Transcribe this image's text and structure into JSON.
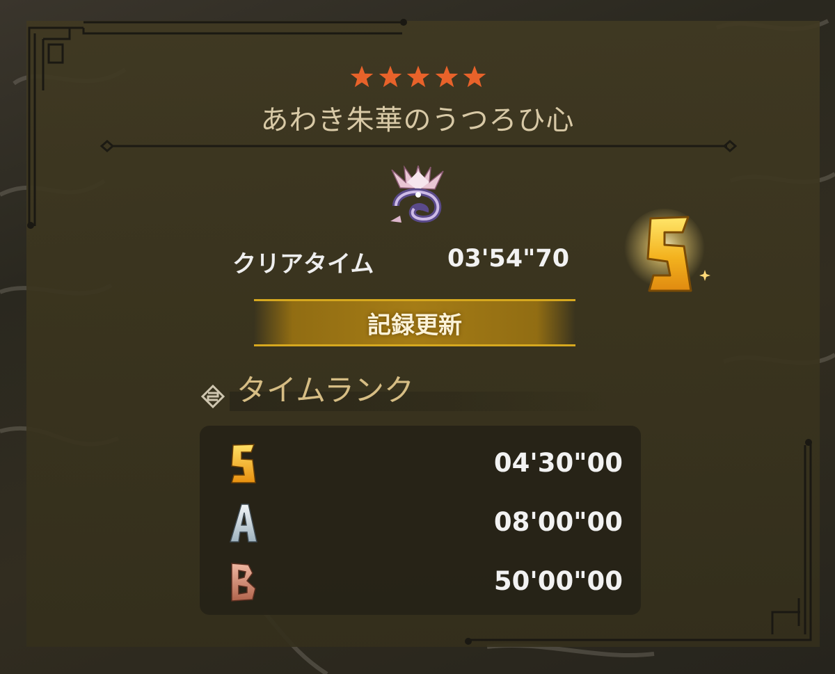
{
  "quest": {
    "stars": 5,
    "title": "あわき朱華のうつろひ心",
    "monster_icon": "mizutsune-icon"
  },
  "result": {
    "clear_label": "クリアタイム",
    "clear_time": "03'54\"70",
    "rank": "S",
    "record_label": "記録更新"
  },
  "time_rank": {
    "title": "タイムランク",
    "rows": [
      {
        "rank": "S",
        "time": "04'30\"00"
      },
      {
        "rank": "A",
        "time": "08'00\"00"
      },
      {
        "rank": "B",
        "time": "50'00\"00"
      }
    ]
  },
  "colors": {
    "star": "#e8622a",
    "rank_s": "#f0b020",
    "rank_a": "#c8d4dc",
    "rank_b": "#c8826a",
    "banner_gold": "#d6a81f",
    "title": "#d8c9a6"
  }
}
